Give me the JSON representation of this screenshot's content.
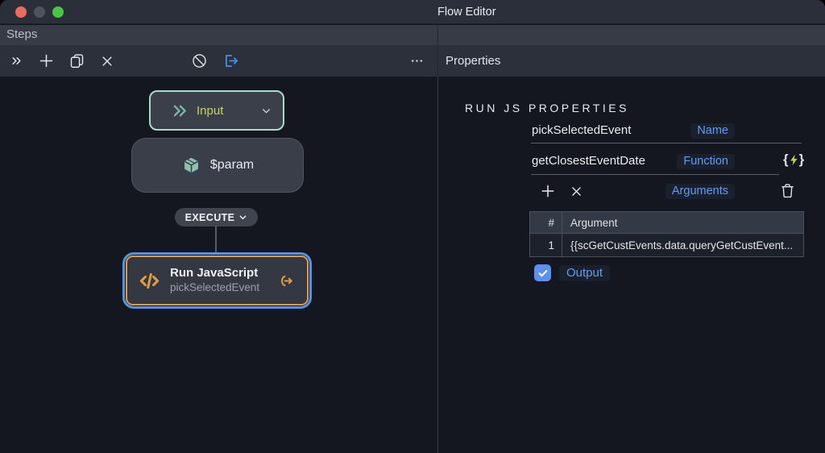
{
  "window": {
    "title": "Flow Editor"
  },
  "steps": {
    "title": "Steps",
    "toolbar": {
      "icons": [
        "chevrons-right",
        "add",
        "duplicate",
        "delete",
        "disable",
        "export",
        "more"
      ]
    },
    "canvas": {
      "input_node": {
        "label": "Input"
      },
      "param_node": {
        "label": "$param"
      },
      "execute_label": "EXECUTE",
      "runjs_node": {
        "title": "Run JavaScript",
        "subtitle": "pickSelectedEvent"
      }
    }
  },
  "properties": {
    "title": "Properties",
    "heading": "RUN JS PROPERTIES",
    "fields": {
      "name": {
        "label": "Name",
        "value": "pickSelectedEvent"
      },
      "function": {
        "label": "Function",
        "value": "getClosestEventDate"
      },
      "arguments": {
        "label": "Arguments"
      }
    },
    "arguments_table": {
      "columns": [
        "#",
        "Argument"
      ],
      "rows": [
        {
          "index": "1",
          "value": "{{scGetCustEvents.data.queryGetCustEvent..."
        }
      ]
    },
    "output": {
      "label": "Output",
      "checked": true
    }
  },
  "colors": {
    "accent_blue_label": "#5f9cf4",
    "selection_blue": "#4f94e8",
    "checkbox_blue": "#5c90f2",
    "export_blue": "#4a8df0",
    "node_mint_border": "#a9dcc8",
    "icon_teal": "#7ab7a4",
    "input_label_yellow": "#c6d55d",
    "orange": "#e09b44",
    "bolt_green": "#b9cf56",
    "titlebar_bg": "#2b2f3a",
    "panel_bar_bg": "#363b46",
    "header_row_bg": "#2b303b",
    "canvas_bg": "#14171f",
    "node_bg": "#3a3f49"
  }
}
